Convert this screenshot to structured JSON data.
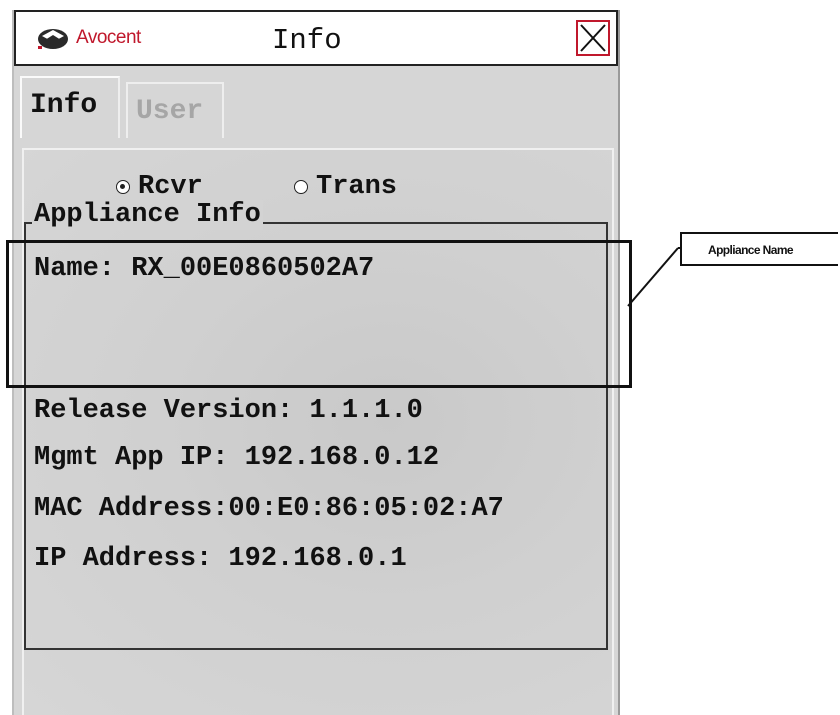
{
  "window": {
    "brand": "Avocent",
    "title": "Info",
    "close_icon": "close-x-icon"
  },
  "tabs": [
    {
      "label": "Info",
      "active": true
    },
    {
      "label": "User",
      "active": false
    }
  ],
  "mode": {
    "options": [
      {
        "label": "Rcvr",
        "selected": true
      },
      {
        "label": "Trans",
        "selected": false
      }
    ]
  },
  "appliance_info": {
    "legend": "Appliance Info",
    "name_line": "Name: RX_00E0860502A7",
    "release_line": "Release Version: 1.1.1.0",
    "mgmt_line": "Mgmt App IP: 192.168.0.12",
    "mac_line": "MAC Address:00:E0:86:05:02:A7",
    "ip_line": "IP Address: 192.168.0.1"
  },
  "callout": {
    "label": "Appliance Name"
  },
  "colors": {
    "brand_red": "#c0182c",
    "window_gray": "#d6d6d6",
    "inactive_tab_text": "#a6a6a6"
  }
}
